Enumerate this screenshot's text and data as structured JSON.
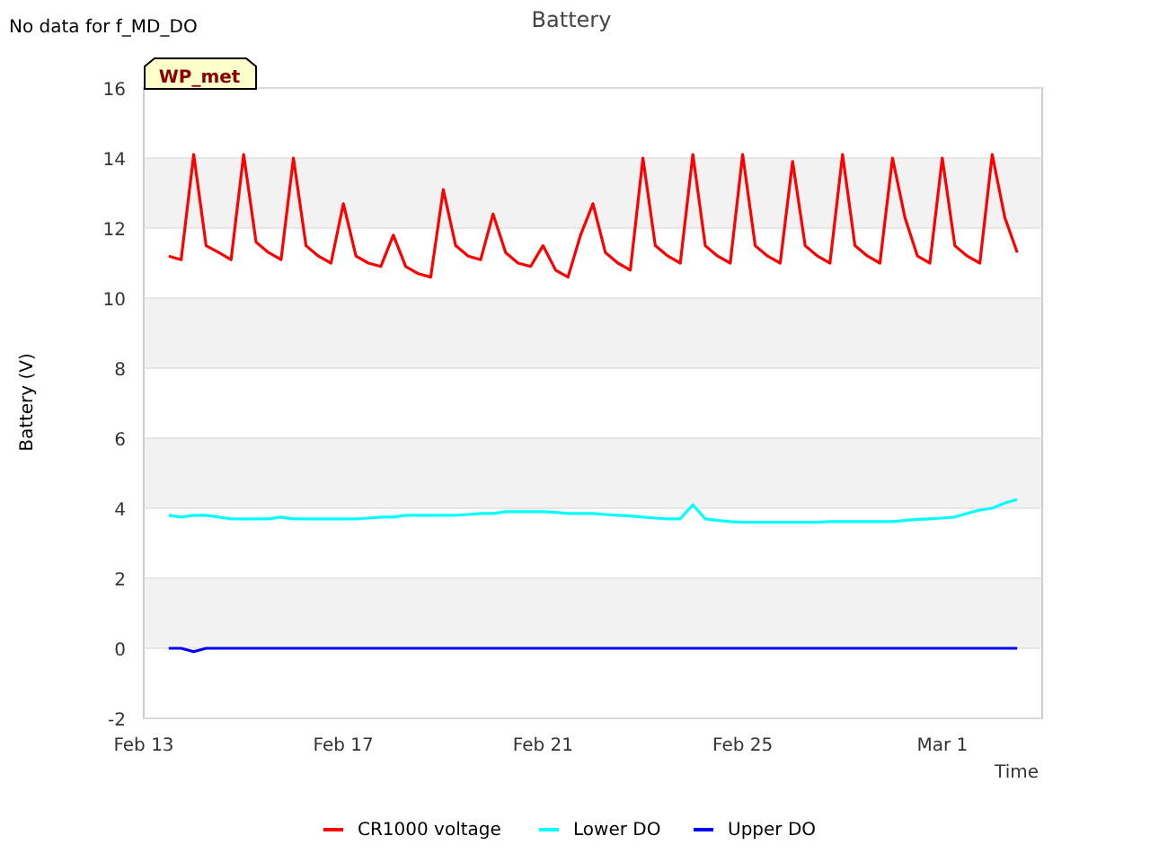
{
  "notice": "No data for f_MD_DO",
  "station_tag": "WP_met",
  "chart": {
    "chart_data": {
      "type": "line",
      "grid": true,
      "legend": "bottom",
      "title": "Battery",
      "xlabel": "Time",
      "ylabel": "Battery (V)",
      "ylim": [
        -2,
        16
      ],
      "yticks": [
        -2,
        0,
        2,
        4,
        6,
        8,
        10,
        12,
        14,
        16
      ],
      "categories": [
        "Feb 13",
        null,
        null,
        null,
        null,
        null,
        null,
        null,
        null,
        null,
        null,
        null,
        null,
        null,
        null,
        null,
        "Feb 17",
        null,
        null,
        null,
        null,
        null,
        null,
        null,
        null,
        null,
        null,
        null,
        null,
        null,
        null,
        null,
        "Feb 21",
        null,
        null,
        null,
        null,
        null,
        null,
        null,
        null,
        null,
        null,
        null,
        null,
        null,
        null,
        null,
        "Feb 25",
        null,
        null,
        null,
        null,
        null,
        null,
        null,
        null,
        null,
        null,
        null,
        null,
        null,
        null,
        null,
        "Mar 1",
        null,
        null,
        null,
        null,
        null,
        null
      ],
      "series": [
        {
          "name": "CR1000 voltage",
          "color": "#ff0000",
          "values": [
            null,
            null,
            11.2,
            11.1,
            14.1,
            11.5,
            11.3,
            11.1,
            14.1,
            11.6,
            11.3,
            11.1,
            14.0,
            11.5,
            11.2,
            11.0,
            12.7,
            11.2,
            11.0,
            10.9,
            11.8,
            10.9,
            10.7,
            10.6,
            13.1,
            11.5,
            11.2,
            11.1,
            12.4,
            11.3,
            11.0,
            10.9,
            11.5,
            10.8,
            10.6,
            11.8,
            12.7,
            11.3,
            11.0,
            10.8,
            14.0,
            11.5,
            11.2,
            11.0,
            14.1,
            11.5,
            11.2,
            11.0,
            14.1,
            11.5,
            11.2,
            11.0,
            13.9,
            11.5,
            11.2,
            11.0,
            14.1,
            11.5,
            11.2,
            11.0,
            14.0,
            12.3,
            11.2,
            11.0,
            14.0,
            11.5,
            11.2,
            11.0,
            14.1,
            12.3,
            11.3
          ]
        },
        {
          "name": "Lower DO",
          "color": "#00ffff",
          "values": [
            null,
            null,
            3.8,
            3.75,
            3.8,
            3.8,
            3.75,
            3.7,
            3.7,
            3.7,
            3.7,
            3.75,
            3.7,
            3.7,
            3.7,
            3.7,
            3.7,
            3.7,
            3.72,
            3.75,
            3.75,
            3.8,
            3.8,
            3.8,
            3.8,
            3.8,
            3.82,
            3.85,
            3.85,
            3.9,
            3.9,
            3.9,
            3.9,
            3.88,
            3.85,
            3.85,
            3.85,
            3.82,
            3.8,
            3.78,
            3.75,
            3.72,
            3.7,
            3.7,
            4.1,
            3.7,
            3.65,
            3.62,
            3.6,
            3.6,
            3.6,
            3.6,
            3.6,
            3.6,
            3.6,
            3.62,
            3.62,
            3.62,
            3.62,
            3.62,
            3.62,
            3.65,
            3.68,
            3.7,
            3.72,
            3.75,
            3.85,
            3.95,
            4.0,
            4.15,
            4.25
          ]
        },
        {
          "name": "Upper DO",
          "color": "#0000ff",
          "values": [
            null,
            null,
            0,
            0,
            -0.1,
            0,
            0,
            0,
            0,
            0,
            0,
            0,
            0,
            0,
            0,
            0,
            0,
            0,
            0,
            0,
            0,
            0,
            0,
            0,
            0,
            0,
            0,
            0,
            0,
            0,
            0,
            0,
            0,
            0,
            0,
            0,
            0,
            0,
            0,
            0,
            0,
            0,
            0,
            0,
            0,
            0,
            0,
            0,
            0,
            0,
            0,
            0,
            0,
            0,
            0,
            0,
            0,
            0,
            0,
            0,
            0,
            0,
            0,
            0,
            0,
            0,
            0,
            0,
            0,
            0,
            0
          ]
        }
      ]
    }
  }
}
